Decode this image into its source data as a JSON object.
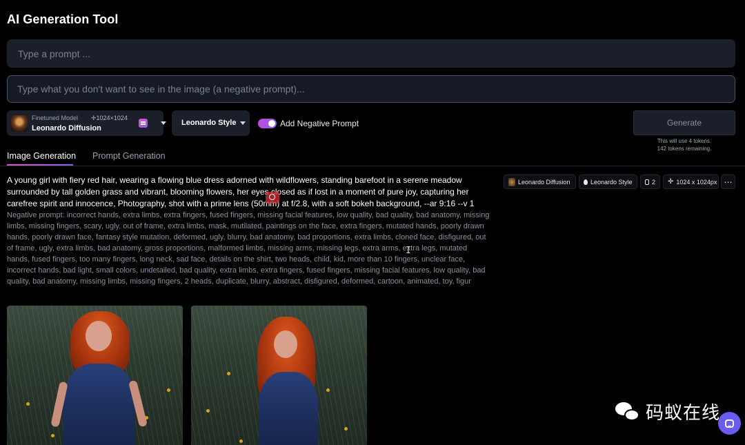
{
  "app": {
    "title": "AI Generation Tool"
  },
  "prompt_input": {
    "placeholder": "Type a prompt ..."
  },
  "negative_input": {
    "placeholder": "Type what you don't want to see in the image (a negative prompt)..."
  },
  "model_select": {
    "caption": "Finetuned Model",
    "size": "✛1024×1024",
    "name": "Leonardo Diffusion"
  },
  "style_select": {
    "label": "Leonardo Style"
  },
  "negative_toggle": {
    "label": "Add Negative Prompt",
    "on": true
  },
  "generate": {
    "label": "Generate",
    "note_line1": "This will use 4 tokens.",
    "note_line2": "142 tokens remaining."
  },
  "tabs": [
    {
      "label": "Image Generation",
      "active": true
    },
    {
      "label": "Prompt Generation",
      "active": false
    }
  ],
  "generation": {
    "prompt": "A young girl with fiery red hair, wearing a flowing blue dress adorned with wildflowers, standing barefoot in a serene meadow surrounded by tall golden grass and vibrant, blooming flowers, her eyes closed as if lost in a moment of pure joy, capturing her carefree spirit and innocence, Photography, shot with a prime lens (50mm) at f/2.8, with a soft bokeh background, --ar 9:16 --v 1",
    "negative_prompt": "Negative prompt: incorrect hands, extra limbs, extra fingers, fused fingers, missing facial features, low quality, bad quality, bad anatomy, missing limbs, missing fingers, scary, ugly, out of frame, extra limbs, mask, mutilated, paintings on the face, extra fingers, mutated hands, poorly drawn hands, poorly drawn face, fantasy style mutation, deformed, ugly, blurry, bad anatomy, bad proportions, extra limbs, cloned face, disfigured, out of frame, ugly, extra limbs, bad anatomy, gross proportions, malformed limbs, missing arms, missing legs, extra arms, extra legs, mutated hands, fused fingers, too many fingers, long neck, sad face, details on the shirt, two heads, child, kid, more than 10 fingers, unclear face, incorrect hands, bad light, small colors, undetailed, bad quality, extra limbs, extra fingers, fused fingers, missing facial features, low quality, bad quality, bad anatomy, missing limbs, missing fingers, 2 heads, duplicate, blurry, abstract, disfigured, deformed, cartoon, animated, toy, figur",
    "chips": {
      "model": "Leonardo Diffusion",
      "style": "Leonardo Style",
      "count": "2",
      "dimensions": "1024 x 1024px",
      "more": "⋯"
    }
  },
  "watermark": {
    "text": "码蚁在线"
  },
  "icons": [
    "style-icon",
    "chevron-down-icon",
    "drop-icon",
    "image-stack-icon",
    "move-arrows-icon",
    "more-icon",
    "chat-icon",
    "wechat-logo"
  ],
  "colors": {
    "accent_start": "#e056c1",
    "accent_end": "#8b5cf6",
    "chat_button": "#6b5cf0",
    "panel": "#1b1f2a"
  }
}
